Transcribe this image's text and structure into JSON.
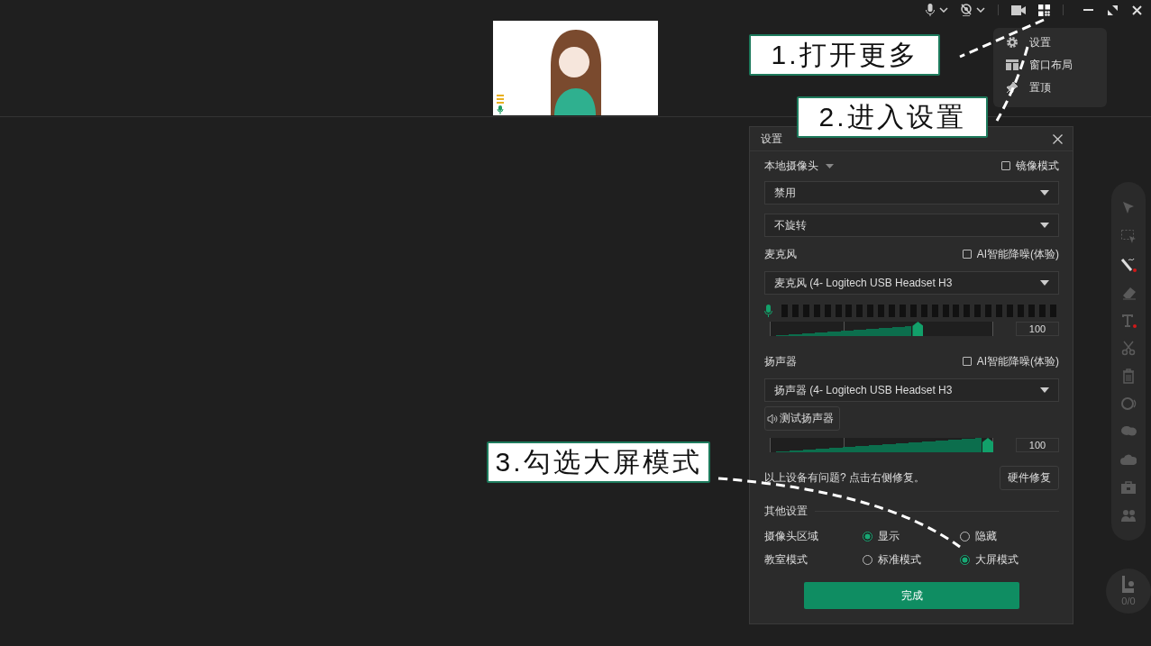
{
  "more_menu": {
    "items": [
      {
        "label": "设置"
      },
      {
        "label": "窗口布局"
      },
      {
        "label": "置顶"
      }
    ]
  },
  "callouts": [
    {
      "text": "1.打开更多"
    },
    {
      "text": "2.进入设置"
    },
    {
      "text": "3.勾选大屏模式"
    }
  ],
  "settings_dialog": {
    "title": "设置",
    "camera": {
      "label": "本地摄像头",
      "mirror": {
        "label": "镜像模式",
        "checked": false
      },
      "selects": [
        {
          "value": "禁用"
        },
        {
          "value": "不旋转"
        }
      ]
    },
    "microphone": {
      "label": "麦克风",
      "denoise": {
        "label": "AI智能降噪(体验)",
        "checked": false
      },
      "device": "麦克风 (4- Logitech USB Headset H3",
      "meter": {
        "level": 0
      },
      "volume": {
        "level": 0.67,
        "value": "100"
      }
    },
    "speaker": {
      "label": "扬声器",
      "denoise": {
        "label": "AI智能降噪(体验)",
        "checked": false
      },
      "device": "扬声器 (4- Logitech USB Headset H3",
      "test_button": "测试扬声器",
      "volume": {
        "level": 1,
        "value": "100"
      }
    },
    "repair": {
      "hint": "以上设备有问题? 点击右侧修复。",
      "button": "硬件修复"
    },
    "other": {
      "title": "其他设置",
      "rows": [
        {
          "label": "摄像头区域",
          "options": [
            {
              "label": "显示",
              "selected": true
            },
            {
              "label": "隐藏",
              "selected": false
            }
          ]
        },
        {
          "label": "教室模式",
          "options": [
            {
              "label": "标准模式",
              "selected": false
            },
            {
              "label": "大屏模式",
              "selected": true
            }
          ]
        }
      ]
    },
    "done_button": "完成"
  },
  "seat_counter": "0/0"
}
